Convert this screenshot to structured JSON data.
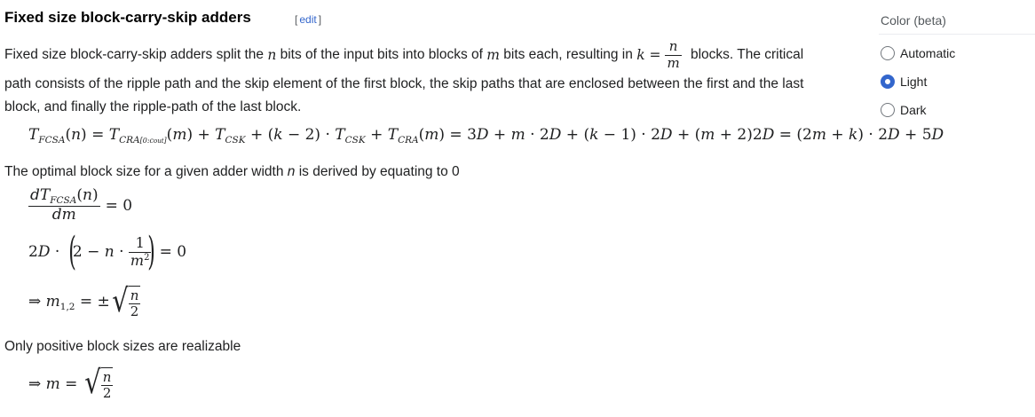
{
  "section": {
    "title": "Fixed size block-carry-skip adders",
    "edit_open": "[",
    "edit_label": "edit",
    "edit_close": "]"
  },
  "paragraph1": {
    "part1": "Fixed size block-carry-skip adders split the ",
    "part2": " bits of the input bits into blocks of ",
    "part3": " bits each, resulting in ",
    "part4": " blocks. The critical",
    "line2": "path consists of the ripple path and the skip element of the first block, the skip paths that are enclosed between the first and the last",
    "line3": "block, and finally the ripple-path of the last block."
  },
  "paragraph2": {
    "part1": "The optimal block size for a given adder width ",
    "part2": " is derived by equating to 0"
  },
  "paragraph3": "Only positive block sizes are realizable",
  "sidebar": {
    "title": "Color (beta)",
    "options": [
      {
        "label": "Automatic",
        "selected": false
      },
      {
        "label": "Light",
        "selected": true
      },
      {
        "label": "Dark",
        "selected": false
      }
    ]
  },
  "colors": {
    "link": "#3366cc",
    "text": "#202122",
    "radio_selected": "#3366cc"
  }
}
